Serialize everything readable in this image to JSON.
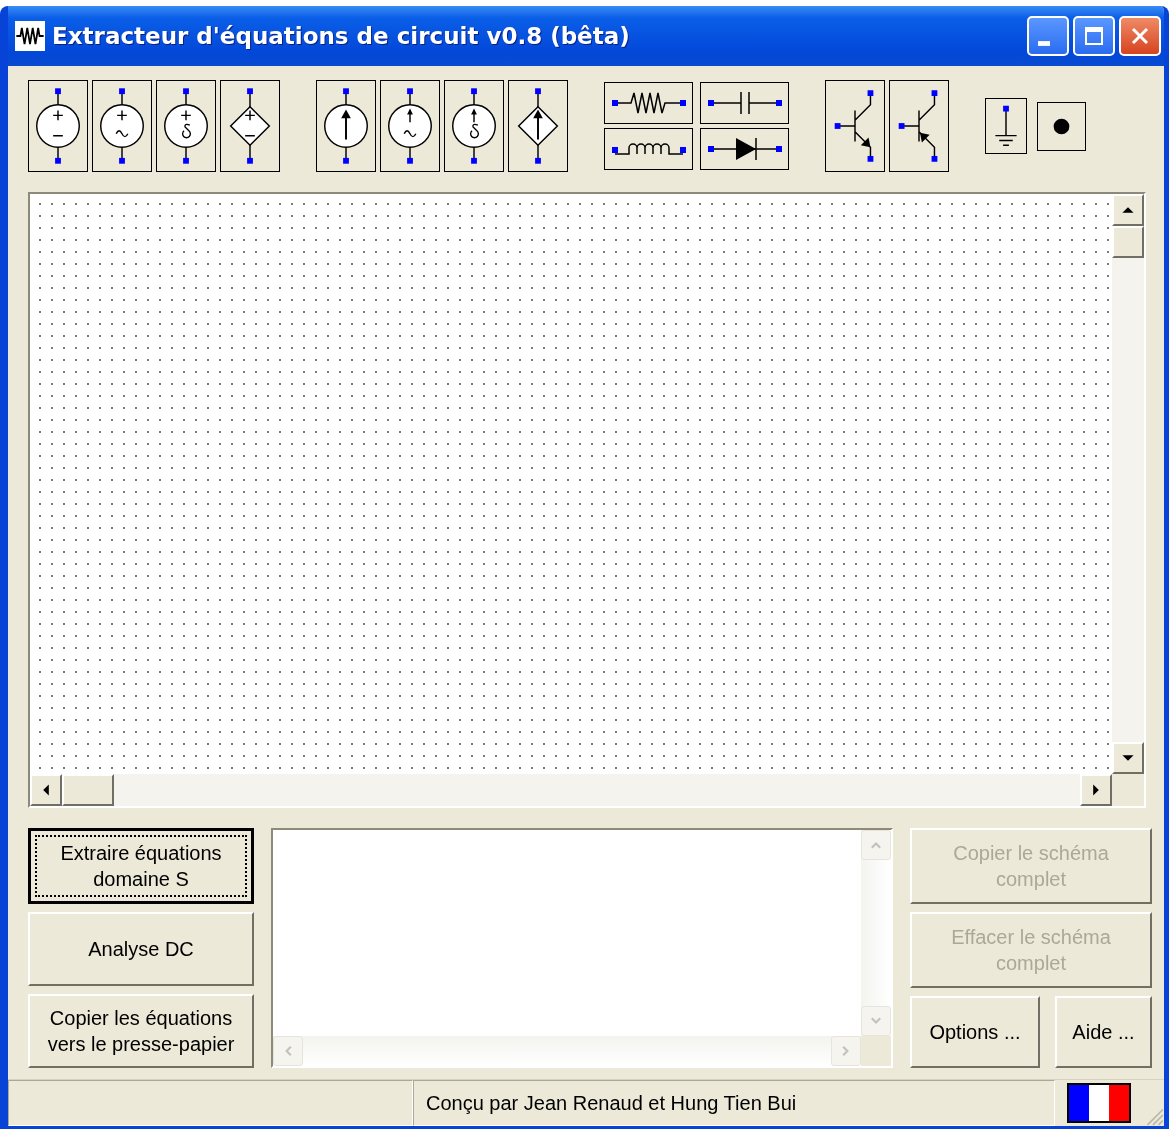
{
  "window": {
    "title": "Extracteur d'équations de circuit v0.8 (bêta)"
  },
  "left_buttons": [
    {
      "label": "Extraire équations\ndomaine S",
      "focused": true,
      "disabled": false
    },
    {
      "label": "Analyse DC",
      "focused": false,
      "disabled": false
    },
    {
      "label": "Copier les équations\nvers le presse-papier",
      "focused": false,
      "disabled": false
    }
  ],
  "right_buttons": [
    {
      "label": "Copier le schéma\ncomplet",
      "disabled": true
    },
    {
      "label": "Effacer le schéma\ncomplet",
      "disabled": true
    }
  ],
  "bottom_buttons": [
    {
      "label": "Options ...",
      "disabled": false
    },
    {
      "label": "Aide ...",
      "disabled": false
    }
  ],
  "status_bar": {
    "text": "Conçu par Jean Renaud et Hung Tien Bui"
  }
}
